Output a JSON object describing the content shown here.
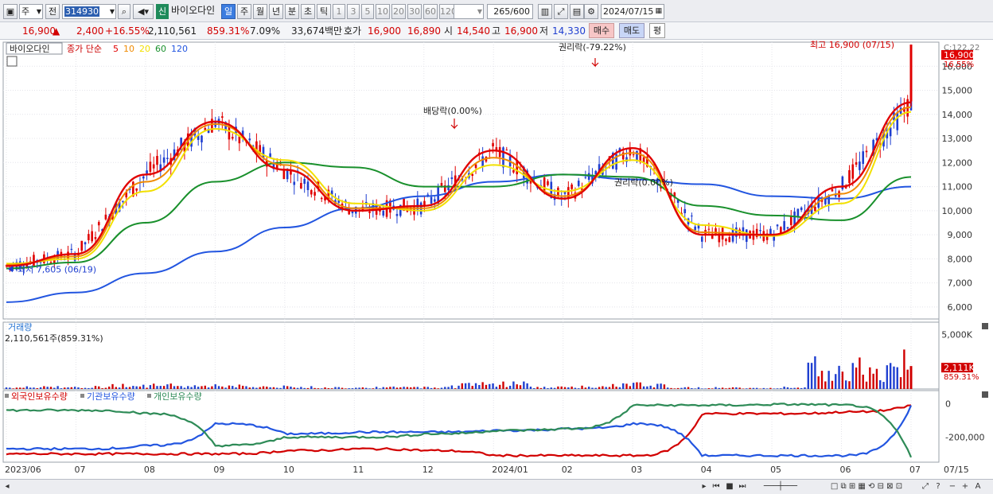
{
  "toolbar": {
    "market_label": "주",
    "prev_label": "전",
    "code": "314930",
    "new_badge": "신",
    "stock_name": "바이오다인",
    "periods": [
      "일",
      "주",
      "월",
      "년",
      "분",
      "초",
      "틱"
    ],
    "selected_period": "일",
    "numbers": [
      "1",
      "3",
      "5",
      "10",
      "20",
      "30",
      "60",
      "120"
    ],
    "count_value": "265",
    "count_total": "/600",
    "date": "2024/07/15"
  },
  "quote": {
    "price": "16,900",
    "change": "2,400",
    "change_pct": "+16.55%",
    "volume": "2,110,561",
    "volume_ratio": "859.31%",
    "turnover": "7.09%",
    "amount": "33,674백만",
    "bid_label": "호가",
    "ask": "16,900",
    "bid": "16,890",
    "open_label": "시",
    "open": "14,540",
    "high_label": "고",
    "high": "16,900",
    "low_label": "저",
    "low": "14,330",
    "buy_label": "매수",
    "sell_label": "매도",
    "eval_label": "평"
  },
  "price_panel": {
    "stock_name": "바이오다인",
    "ma_title": "종가 단순",
    "ma_periods": [
      "5",
      "10",
      "20",
      "60",
      "120"
    ],
    "ma_colors": [
      "#e10000",
      "#f08a00",
      "#f2e000",
      "#19902c",
      "#2255e0"
    ],
    "current_price_label": "16,900",
    "current_pct_label": "16.55%",
    "top_label": "C:122.22",
    "y_ticks": [
      "16,000",
      "15,000",
      "14,000",
      "13,000",
      "12,000",
      "11,000",
      "10,000",
      "9,000",
      "8,000",
      "7,000",
      "6,000"
    ],
    "annotations": {
      "high": "최고 16,900 (07/15)",
      "low": "최저 7,605 (06/19)",
      "rights": "권리락(-79.22%)",
      "dividend": "배당락(0.00%)",
      "rights2": "권리락(0.00%)"
    }
  },
  "volume_panel": {
    "title": "거래량",
    "value_text": "2,110,561주(859.31%)",
    "y_tick": "5,000K",
    "current_label": "2,111K",
    "current_pct": "859.31%"
  },
  "holding_panel": {
    "legend": [
      "외국인보유수량",
      "기관보유수량",
      "개인보유수량"
    ],
    "legend_colors": [
      "#d20000",
      "#2255e0",
      "#2e8b57"
    ],
    "y_ticks": [
      "0",
      "-200,000"
    ]
  },
  "x_axis": {
    "labels": [
      "2023/06",
      "07",
      "08",
      "09",
      "10",
      "11",
      "12",
      "2024/01",
      "02",
      "03",
      "04",
      "05",
      "06",
      "07"
    ],
    "right_label": "07/15"
  },
  "chart_data": [
    {
      "type": "line",
      "title": "",
      "x": [
        "2023/06",
        "07",
        "08",
        "09",
        "10",
        "11",
        "12",
        "2024/01",
        "02",
        "03",
        "04",
        "05",
        "06",
        "07"
      ],
      "series": [
        {
          "name": "5",
          "values": [
            7700,
            8200,
            11500,
            13700,
            11700,
            10000,
            10200,
            12500,
            10500,
            12600,
            9000,
            9000,
            11000,
            14500
          ]
        },
        {
          "name": "10",
          "values": [
            7750,
            8100,
            11200,
            13600,
            11900,
            10100,
            10100,
            12200,
            10600,
            12400,
            9100,
            9000,
            10700,
            14300
          ]
        },
        {
          "name": "20",
          "values": [
            7800,
            8000,
            10800,
            13400,
            12100,
            10300,
            10000,
            11900,
            10800,
            12100,
            9400,
            8950,
            10300,
            14100
          ]
        },
        {
          "name": "60",
          "values": [
            7600,
            7850,
            9500,
            11200,
            12000,
            11800,
            11000,
            11000,
            11500,
            11400,
            10200,
            9800,
            9600,
            11400
          ]
        },
        {
          "name": "120",
          "values": [
            6200,
            6600,
            7400,
            8300,
            9300,
            10100,
            10600,
            11200,
            11500,
            11300,
            11100,
            10600,
            10500,
            11000
          ]
        }
      ],
      "ylim": [
        5500,
        17000
      ],
      "ymark": {
        "max": 16900,
        "min": 7605
      }
    },
    {
      "type": "bar",
      "title": "거래량",
      "categories": [
        "2023/06",
        "07",
        "08",
        "09",
        "10",
        "11",
        "12",
        "2024/01",
        "02",
        "03",
        "04",
        "05",
        "06",
        "07"
      ],
      "values": [
        150,
        260,
        440,
        380,
        230,
        180,
        200,
        660,
        210,
        560,
        160,
        140,
        2700,
        2111
      ],
      "ylabel": "K"
    },
    {
      "type": "line",
      "x": [
        "2023/06",
        "07",
        "08",
        "09",
        "10",
        "11",
        "12",
        "2024/01",
        "02",
        "03",
        "04",
        "05",
        "06",
        "07"
      ],
      "series": [
        {
          "name": "외국인보유수량",
          "values": [
            -300000,
            -300000,
            -300000,
            -300000,
            -280000,
            -270000,
            -280000,
            -310000,
            -310000,
            -310000,
            -60000,
            -60000,
            -50000,
            -10000
          ]
        },
        {
          "name": "기관보유수량",
          "values": [
            -270000,
            -270000,
            -250000,
            -120000,
            -180000,
            -170000,
            -170000,
            -160000,
            -150000,
            -120000,
            -310000,
            -310000,
            -310000,
            -10000
          ]
        },
        {
          "name": "개인보유수량",
          "values": [
            -40000,
            -40000,
            -60000,
            -250000,
            -200000,
            -200000,
            -180000,
            -160000,
            -150000,
            -10000,
            -10000,
            -5000,
            -10000,
            -320000
          ]
        }
      ]
    }
  ]
}
